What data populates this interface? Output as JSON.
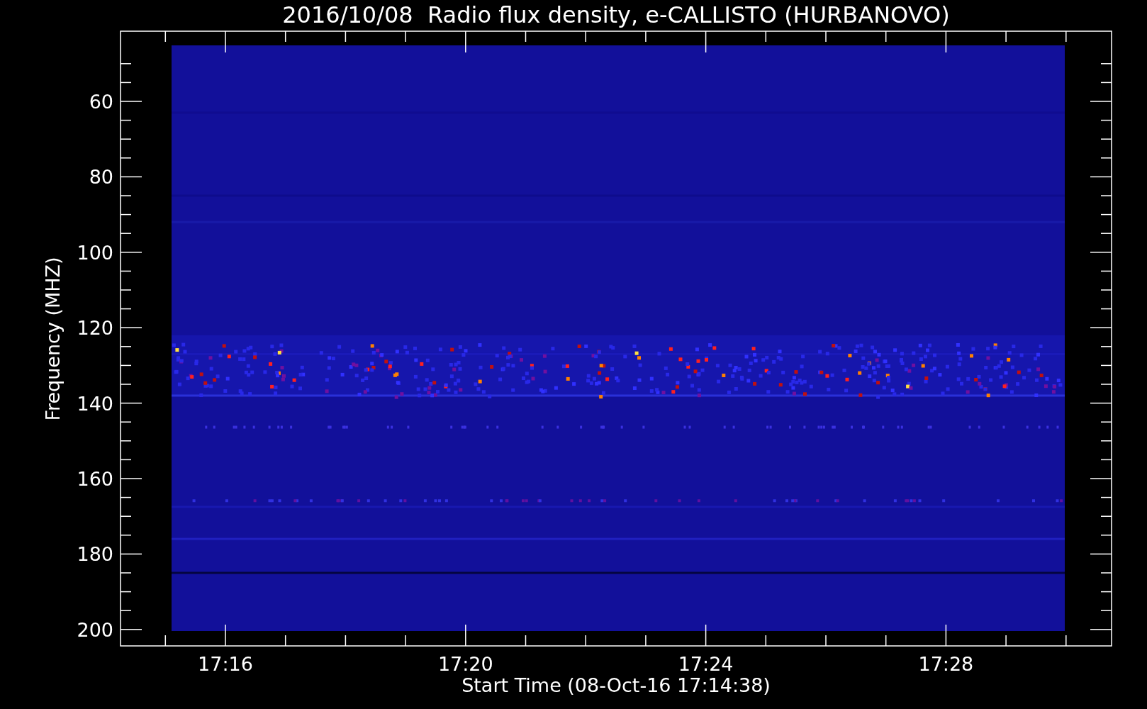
{
  "title": "2016/10/08  Radio flux density, e-CALLISTO (HURBANOVO)",
  "y_axis": {
    "label": "Frequency (MHZ)",
    "ticks": [
      "60",
      "80",
      "100",
      "120",
      "140",
      "160",
      "180",
      "200"
    ]
  },
  "x_axis": {
    "label": "Start Time (08-Oct-16 17:14:38)",
    "ticks": [
      "17:16",
      "17:20",
      "17:24",
      "17:28"
    ]
  }
}
